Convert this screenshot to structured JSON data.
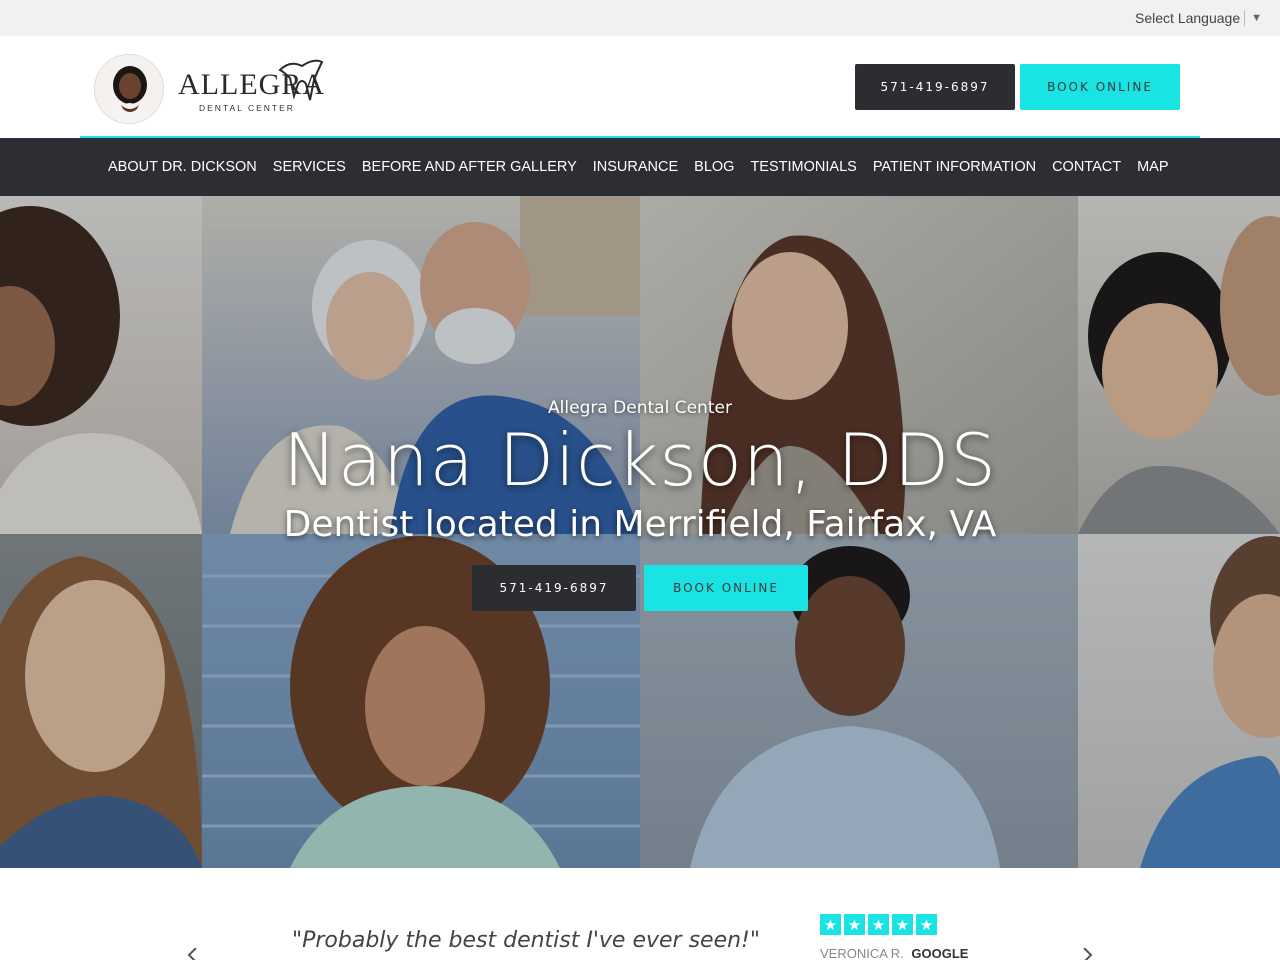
{
  "language": {
    "label": "Select Language",
    "arrow": "▼"
  },
  "header": {
    "logo_name": "ALLEGRA",
    "logo_sub": "DENTAL CENTER",
    "phone": "571-419-6897",
    "book": "BOOK ONLINE"
  },
  "nav": {
    "items": [
      "ABOUT DR. DICKSON",
      "SERVICES",
      "BEFORE AND AFTER GALLERY",
      "INSURANCE",
      "BLOG",
      "TESTIMONIALS",
      "PATIENT INFORMATION",
      "CONTACT",
      "MAP"
    ]
  },
  "hero": {
    "eyebrow": "Allegra Dental Center",
    "title": "Nana Dickson, DDS",
    "subtitle": "Dentist located in Merrifield, Fairfax, VA",
    "phone": "571-419-6897",
    "book": "BOOK ONLINE"
  },
  "review": {
    "quote": "\"Probably the best dentist I've ever seen!\"",
    "rating": 5,
    "reviewer": "VERONICA R.",
    "source": "GOOGLE"
  },
  "colors": {
    "accent": "#19e3e3",
    "dark": "#2d2e33"
  },
  "icons": {
    "prev": "chevron-left-icon",
    "next": "chevron-right-icon",
    "star": "star-icon",
    "dropdown": "triangle-down-icon"
  }
}
